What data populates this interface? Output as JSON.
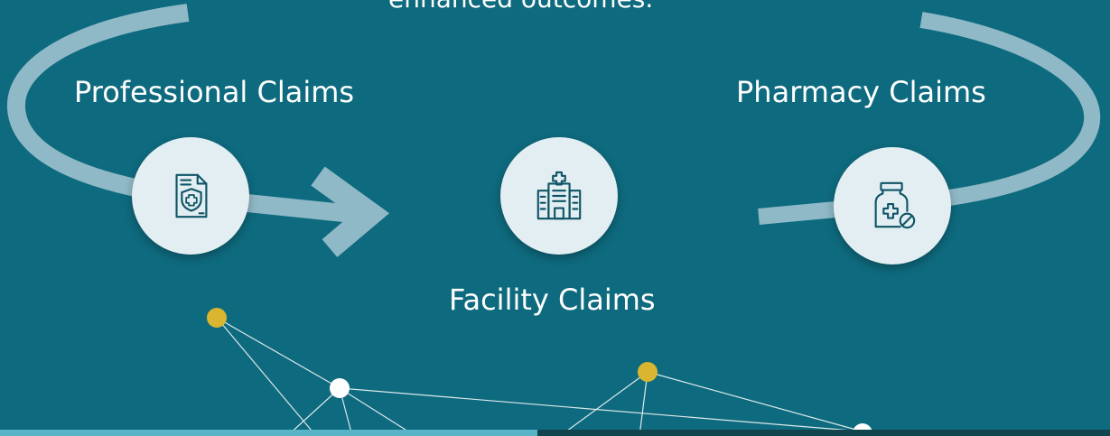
{
  "intro_text": "enhanced outcomes.",
  "nodes": [
    {
      "label": "Professional Claims",
      "icon": "document-shield-icon"
    },
    {
      "label": "Facility Claims",
      "icon": "hospital-building-icon"
    },
    {
      "label": "Pharmacy Claims",
      "icon": "medicine-bottle-icon"
    }
  ],
  "colors": {
    "background": "#0e6a7e",
    "arrow": "#8fb9c6",
    "bubble": "#e3eef2",
    "icon_stroke": "#0e5466",
    "network_gold": "#d9b530",
    "network_white": "#ffffff",
    "bar_left": "#58b4c6",
    "bar_right": "#11444f"
  }
}
